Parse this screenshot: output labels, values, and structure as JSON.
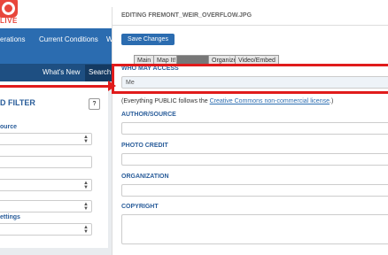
{
  "site": {
    "logo_text": "LIVE"
  },
  "nav": {
    "items": [
      "erations",
      "Current Conditions",
      "W"
    ]
  },
  "subnav": {
    "whats_new": "What's New",
    "search": "Search"
  },
  "left_panel": {
    "filter_title": "D FILTER",
    "help": "?",
    "labels": [
      "ource",
      "ettings"
    ]
  },
  "modal": {
    "title": "EDITING FREMONT_WEIR_OVERFLOW.JPG",
    "save_button": "Save Changes",
    "tabs": [
      "Main",
      "Map It!",
      "Metadata",
      "Organize",
      "Video/Embed"
    ],
    "who_may_access_label": "WHO MAY ACCESS",
    "who_may_access_value": "Me",
    "note_prefix": "(Everything PUBLIC follows the ",
    "note_link": "Creative Commons non-commercial license",
    "note_suffix": ".)",
    "author_label": "AUTHOR/SOURCE",
    "photo_credit_label": "PHOTO CREDIT",
    "organization_label": "ORGANIZATION",
    "copyright_label": "COPYRIGHT"
  },
  "colors": {
    "brand": "#2b6cb0",
    "highlight": "#e01b1b"
  }
}
